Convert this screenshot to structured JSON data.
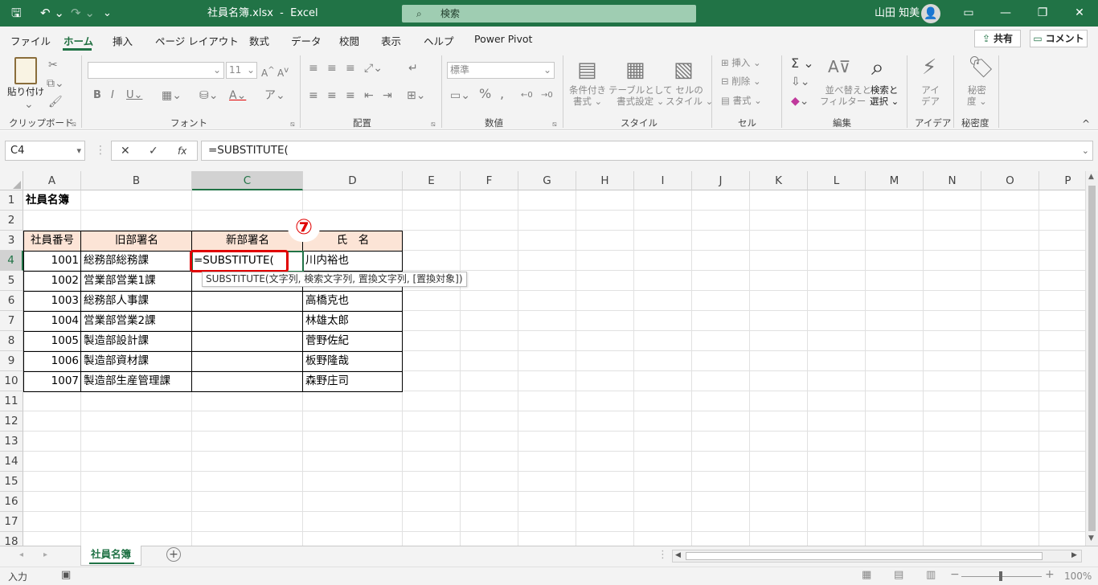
{
  "titlebar": {
    "filename": "社員名簿.xlsx",
    "separator": "-",
    "app": "Excel",
    "search_placeholder": "検索",
    "user": "山田 知美",
    "accent": "#217346"
  },
  "tabs": [
    "ファイル",
    "ホーム",
    "挿入",
    "ページ レイアウト",
    "数式",
    "データ",
    "校閲",
    "表示",
    "ヘルプ",
    "Power Pivot"
  ],
  "share_label": "共有",
  "comment_label": "コメント",
  "ribbon": {
    "clipboard": {
      "paste": "貼り付け",
      "label": "クリップボード"
    },
    "font": {
      "size": "11",
      "label": "フォント"
    },
    "alignment": {
      "label": "配置"
    },
    "number": {
      "format": "標準",
      "label": "数値"
    },
    "styles": {
      "cond1": "条件付き",
      "cond2": "書式",
      "table1": "テーブルとして",
      "table2": "書式設定",
      "cell1": "セルの",
      "cell2": "スタイル",
      "label": "スタイル"
    },
    "cells": {
      "insert": "挿入",
      "delete": "削除",
      "format": "書式",
      "label": "セル"
    },
    "editing": {
      "sort1": "並べ替えと",
      "sort2": "フィルター",
      "find1": "検索と",
      "find2": "選択",
      "label": "編集"
    },
    "ideas": {
      "l1": "アイ",
      "l2": "デア",
      "label": "アイデア"
    },
    "sensitivity": {
      "l1": "秘密",
      "l2": "度",
      "label": "秘密度"
    }
  },
  "formula": {
    "namebox": "C4",
    "content": "=SUBSTITUTE("
  },
  "columns": [
    "A",
    "B",
    "C",
    "D",
    "E",
    "F",
    "G",
    "H",
    "I",
    "J",
    "K",
    "L",
    "M",
    "N",
    "O",
    "P"
  ],
  "rows": [
    "1",
    "2",
    "3",
    "4",
    "5",
    "6",
    "7",
    "8",
    "9",
    "10",
    "11",
    "12",
    "13",
    "14",
    "15",
    "16",
    "17",
    "18"
  ],
  "sheet": {
    "title": "社員名簿",
    "headers": [
      "社員番号",
      "旧部署名",
      "新部署名",
      "氏　名"
    ],
    "records": [
      {
        "id": "1001",
        "dept": "総務部総務課",
        "name": "川内裕也"
      },
      {
        "id": "1002",
        "dept": "営業部営業1課",
        "name": ""
      },
      {
        "id": "1003",
        "dept": "総務部人事課",
        "name": "高橋克也"
      },
      {
        "id": "1004",
        "dept": "営業部営業2課",
        "name": "林雄太郎"
      },
      {
        "id": "1005",
        "dept": "製造部設計課",
        "name": "菅野佐紀"
      },
      {
        "id": "1006",
        "dept": "製造部資材課",
        "name": "板野隆哉"
      },
      {
        "id": "1007",
        "dept": "製造部生産管理課",
        "name": "森野庄司"
      }
    ],
    "editing_value": "=SUBSTITUTE(",
    "tooltip": "SUBSTITUTE(文字列, 検索文字列, 置換文字列, [置換対象])",
    "step_marker": "⑦",
    "header_fill": "#fce4d6",
    "highlight": "#e00000"
  },
  "sheet_tab": "社員名簿",
  "status": {
    "mode": "入力",
    "zoom": "100%"
  }
}
